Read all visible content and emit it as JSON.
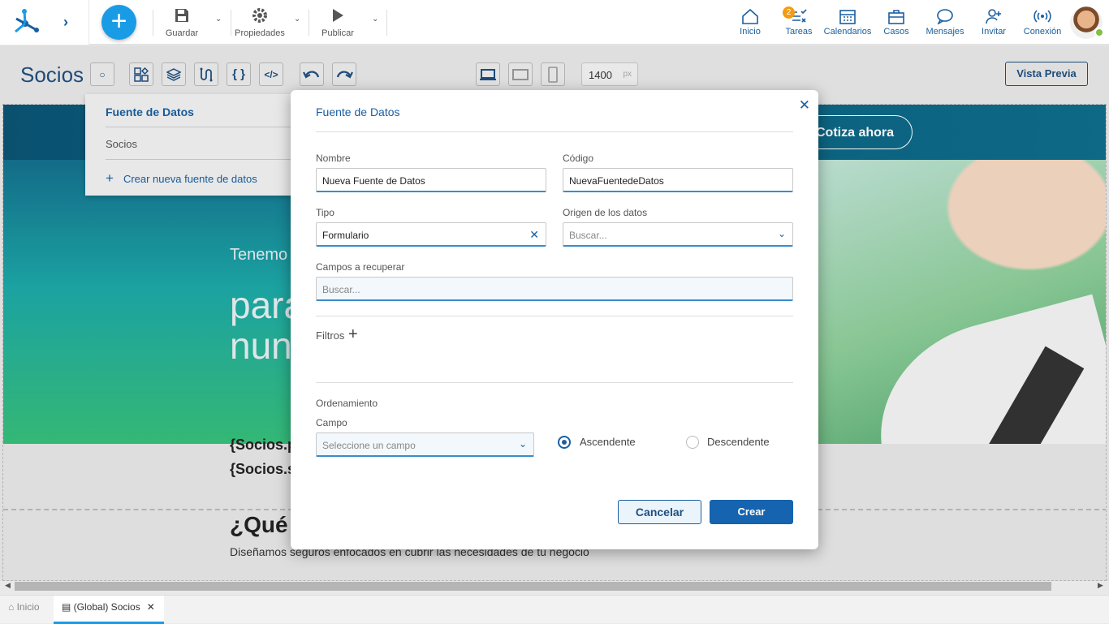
{
  "topbar": {
    "toolbar": [
      {
        "label": "Guardar",
        "icon": "save-icon"
      },
      {
        "label": "Propiedades",
        "icon": "gear-icon"
      },
      {
        "label": "Publicar",
        "icon": "play-icon"
      }
    ],
    "nav": [
      {
        "label": "Inicio",
        "icon": "home-icon"
      },
      {
        "label": "Tareas",
        "icon": "tasks-icon"
      },
      {
        "label": "Calendarios",
        "icon": "calendar-icon"
      },
      {
        "label": "Casos",
        "icon": "briefcase-icon"
      },
      {
        "label": "Mensajes",
        "icon": "chat-icon"
      },
      {
        "label": "Invitar",
        "icon": "invite-icon"
      },
      {
        "label": "Conexión",
        "icon": "signal-icon"
      }
    ],
    "tasks_badge": "2"
  },
  "editor": {
    "title": "Socios",
    "width_value": "1400",
    "width_unit": "px",
    "preview_label": "Vista Previa"
  },
  "canvas": {
    "cta": "Cotiza ahora",
    "hero_line1": "Tenemo",
    "hero_line2": "para",
    "hero_line3": "nun",
    "var1": "{Socios.p",
    "var2": "{Socios.s",
    "section_title": "¿Qué",
    "section_text": "Diseñamos seguros enfocados en cubrir las necesidades de tu negocio"
  },
  "datasource_menu": {
    "heading": "Fuente de Datos",
    "item": "Socios",
    "create": "Crear nueva fuente de datos"
  },
  "modal": {
    "title": "Fuente de Datos",
    "nombre_label": "Nombre",
    "nombre_value": "Nueva Fuente de Datos",
    "codigo_label": "Código",
    "codigo_value": "NuevaFuentedeDatos",
    "tipo_label": "Tipo",
    "tipo_value": "Formulario",
    "origen_label": "Origen de los datos",
    "origen_placeholder": "Buscar...",
    "campos_label": "Campos a recuperar",
    "campos_placeholder": "Buscar...",
    "filtros_label": "Filtros",
    "orden_label": "Ordenamiento",
    "campo_label": "Campo",
    "campo_placeholder": "Seleccione un campo",
    "asc_label": "Ascendente",
    "desc_label": "Descendente",
    "cancel_label": "Cancelar",
    "create_label": "Crear"
  },
  "tabs": [
    {
      "label": "Inicio"
    },
    {
      "label": "(Global) Socios"
    }
  ],
  "colors": {
    "accent": "#1a5fa0",
    "primary_button": "#1663b0",
    "add_button": "#1a9be6",
    "badge": "#f39c12"
  }
}
